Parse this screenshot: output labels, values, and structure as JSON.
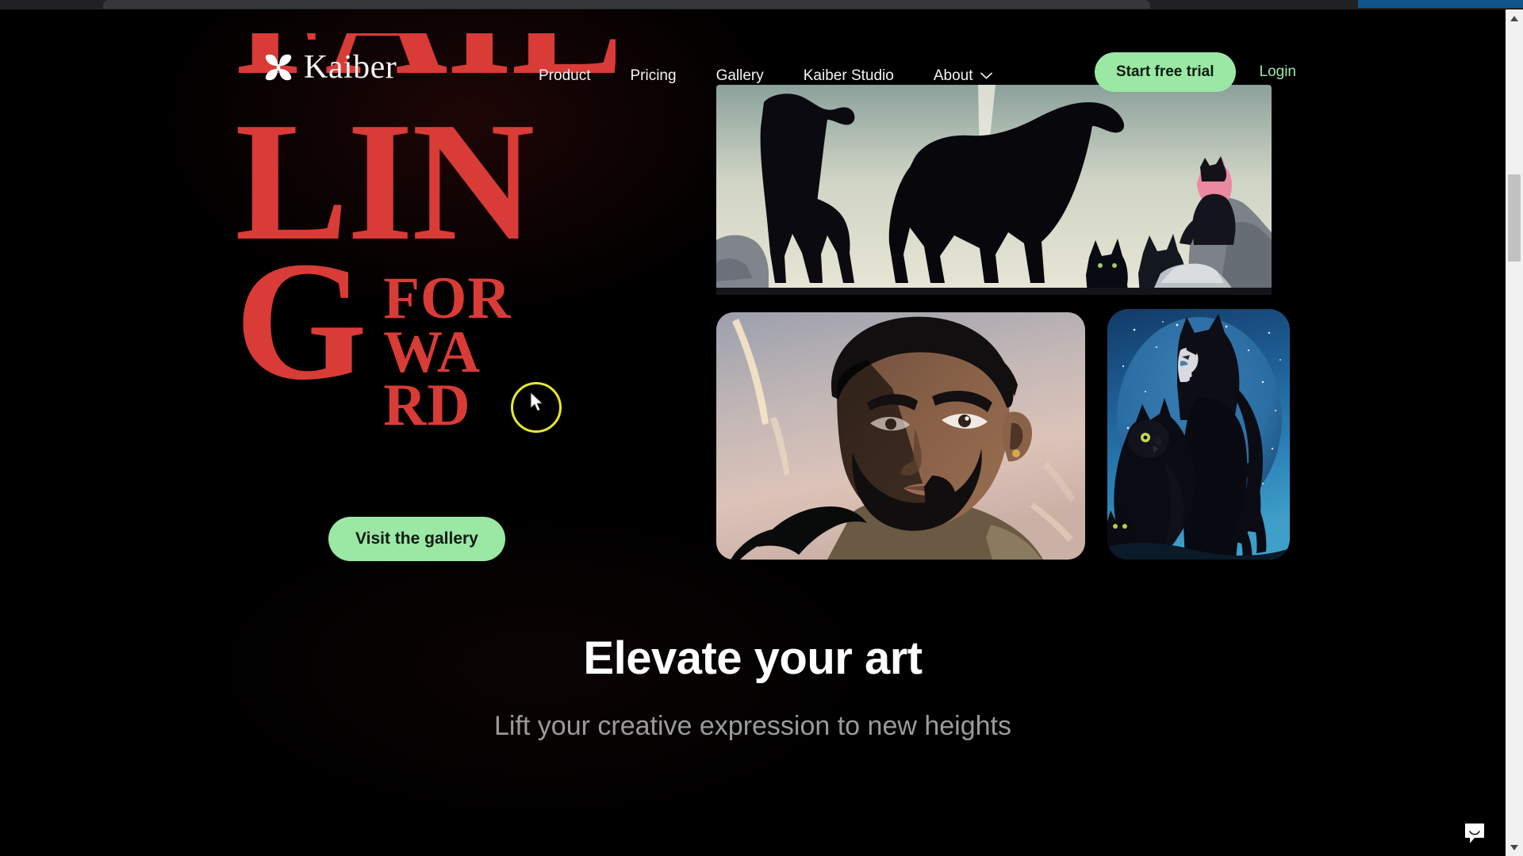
{
  "browser": {
    "scrollbar": {
      "up_icon": "scroll-up-arrow-icon",
      "down_icon": "scroll-down-arrow-icon"
    }
  },
  "nav": {
    "brand_name": "Kaiber",
    "brand_icon": "kaiber-logo-icon",
    "links": [
      {
        "label": "Product"
      },
      {
        "label": "Pricing"
      },
      {
        "label": "Gallery"
      },
      {
        "label": "Kaiber Studio"
      },
      {
        "label": "About",
        "icon": "chevron-down-icon",
        "has_dropdown": true
      }
    ],
    "start_trial_label": "Start free trial",
    "login_label": "Login"
  },
  "hero": {
    "headline_cut_line": "FAIL",
    "headline_line_2": "LIN",
    "headline_big_letter": "G",
    "headline_stacked": [
      "FOR",
      "WA",
      "RD"
    ],
    "gallery_button_label": "Visit the gallery",
    "accent_red": "#d93b36",
    "accent_green": "#9ae8a4"
  },
  "media": [
    {
      "name": "wolves-scene",
      "description": "Dark wolf silhouettes on pale gradient sky with pink-haired figure on rocks"
    },
    {
      "name": "portrait-scene",
      "description": "Stylized portrait of bearded man with dramatic face shadow against muted sky"
    },
    {
      "name": "owl-figure-scene",
      "description": "Horned dark-haired figure with owl under a starry blue night sky"
    }
  ],
  "section": {
    "title": "Elevate your art",
    "subtitle": "Lift your creative expression to new heights"
  },
  "widgets": {
    "chat_icon": "chat-bubble-smile-icon"
  },
  "cursor": {
    "highlight_color": "#e8e82a"
  }
}
